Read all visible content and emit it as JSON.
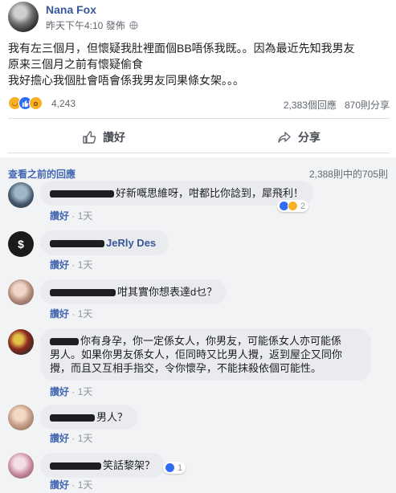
{
  "post": {
    "author": "Nana Fox",
    "meta": "昨天下午4:10 發佈",
    "body_lines": [
      "我有左三個月，但懷疑我肚裡面個BB唔係我既。。因為最近先知我男友",
      "原来三個月之前有懷疑偷食",
      "我好擔心我個肚會唔會係我男友同果條女架。。。"
    ],
    "reaction_count": "4,243",
    "comment_count": "2,383個回應",
    "share_count": "870則分享",
    "like_label": "讚好",
    "share_label": "分享"
  },
  "comments_section": {
    "earlier_link": "查看之前的回應",
    "earlier_count": "2,388則中的705則",
    "like_word": "讚好",
    "time": "1天",
    "comments": [
      {
        "name": "",
        "text": "好新嘅思維呀，咁都比你諗到，犀飛利！",
        "reaction_count": "2"
      },
      {
        "name": "JeRly Des",
        "text": ""
      },
      {
        "name": "",
        "text": "咁其實你想表達d乜？"
      },
      {
        "name": "",
        "text_lines": [
          "你有身孕，你一定係女人，你男友，可能係女人亦可能係",
          "男人。如果你男友係女人，佢同時又比男人攪，返到屋企又同你",
          "攪，而且又互相手指交，令你懷孕，不能抹殺依個可能性。"
        ]
      },
      {
        "name": "",
        "text": "男人？"
      },
      {
        "name": "",
        "text": "笑話黎架？",
        "reaction_count": "1"
      }
    ]
  },
  "colors": {
    "link": "#365899",
    "accent": "#4267b2",
    "bubble": "#e9ebee",
    "page_bg": "#f2f3f5"
  }
}
